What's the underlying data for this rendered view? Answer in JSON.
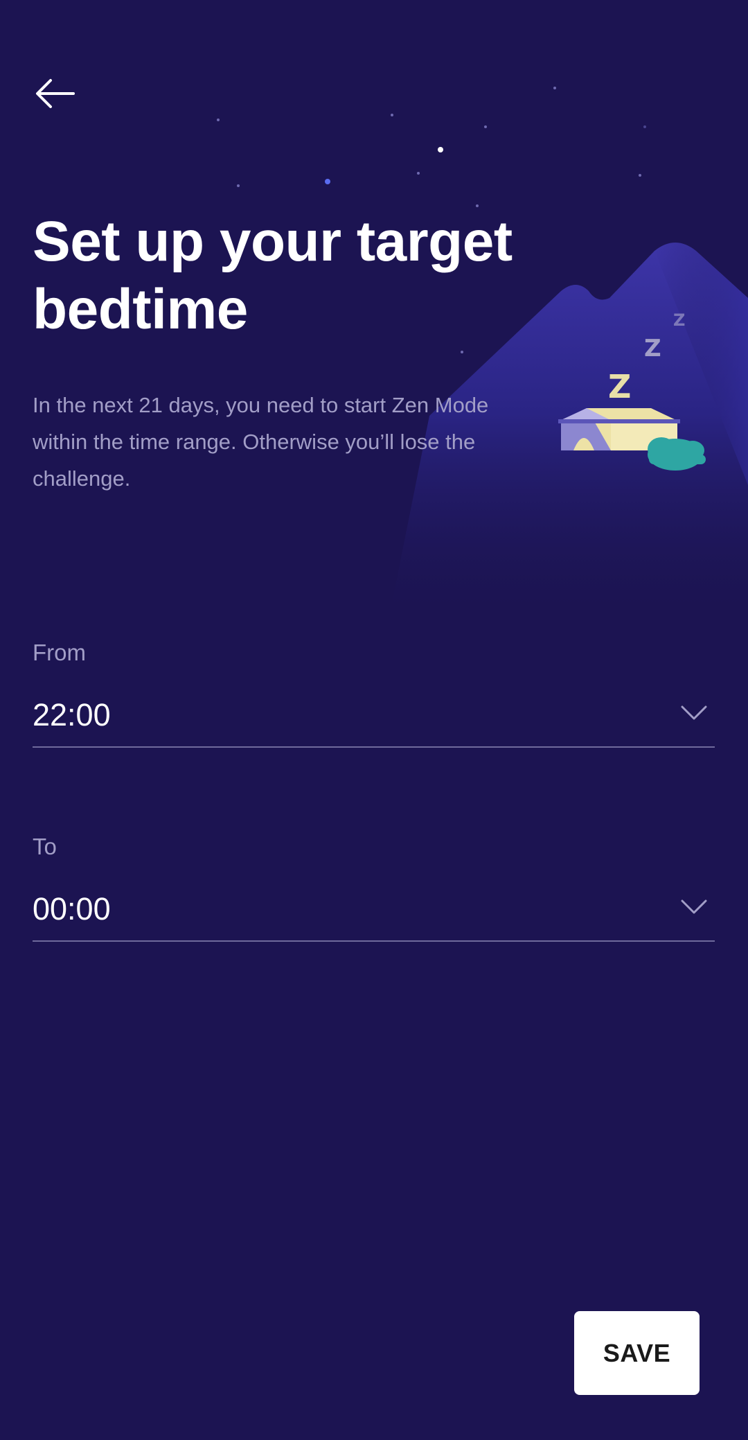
{
  "header": {
    "back_icon": "arrow-left-icon"
  },
  "title": "Set up your target bedtime",
  "description": "In the next 21 days, you need to start Zen Mode within the time range. Otherwise you’ll lose the challenge.",
  "illustration": {
    "icon": "sleeping-tent-illustration",
    "sleep_letters": [
      "Z",
      "Z",
      "Z"
    ]
  },
  "from_field": {
    "label": "From",
    "value": "22:00",
    "icon": "chevron-down-icon"
  },
  "to_field": {
    "label": "To",
    "value": "00:00",
    "icon": "chevron-down-icon"
  },
  "actions": {
    "save_label": "SAVE"
  },
  "colors": {
    "background": "#1c1452",
    "mountain": "#2e2891",
    "label_text": "#a29ec7",
    "divider": "#6f6a9c",
    "button_bg": "#ffffff"
  }
}
